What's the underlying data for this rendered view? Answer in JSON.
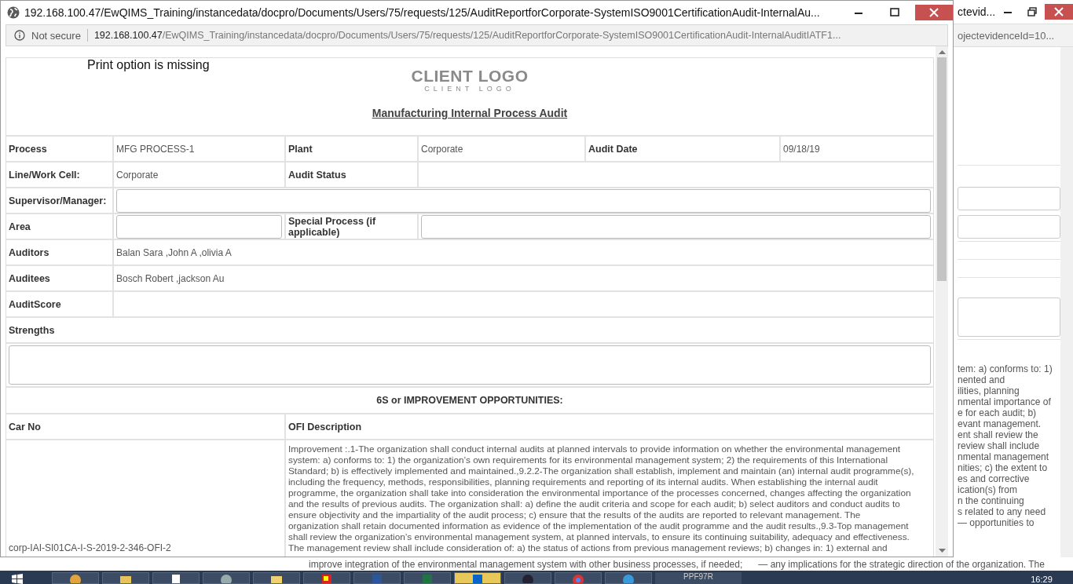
{
  "background_window": {
    "title": "ctevid...",
    "address": "ojectevidenceId=10...",
    "text_lines": [
      "tem: a) conforms to: 1)",
      "nented and",
      "ilities, planning",
      "nmental importance of",
      "e for each audit; b)",
      "evant management.",
      "ent shall review the",
      "review shall include",
      "nmental management",
      "nities; c) the extent to",
      "es and corrective",
      "ication(s) from",
      "n the continuing",
      "s related to any need",
      "— opportunities to"
    ],
    "bottom_texts": [
      "improve integration of the environmental management system with other business processes, if needed;",
      "— any implications for the strategic direction of the organization. The"
    ]
  },
  "popup": {
    "title": "192.168.100.47/EwQIMS_Training/instancedata/docpro/Documents/Users/75/requests/125/AuditReportforCorporate-SystemISO9001CertificationAudit-InternalAu...",
    "security": "Not secure",
    "url_host": "192.168.100.47",
    "url_path": "/EwQIMS_Training/instancedata/docpro/Documents/Users/75/requests/125/AuditReportforCorporate-SystemISO9001CertificationAudit-InternalAuditIATF1..."
  },
  "document": {
    "note": "Print option is missing",
    "logo": "CLIENT LOGO",
    "logo_sub": "CLIENT LOGO",
    "title": "Manufacturing Internal Process Audit",
    "rows": [
      {
        "kind": "six",
        "cells": [
          {
            "kind": "label",
            "text": "Process"
          },
          {
            "kind": "value",
            "text": "MFG PROCESS-1"
          },
          {
            "kind": "label",
            "text": "Plant"
          },
          {
            "kind": "value",
            "text": "Corporate"
          },
          {
            "kind": "label",
            "text": "Audit Date"
          },
          {
            "kind": "value",
            "text": "09/18/19"
          }
        ]
      },
      {
        "kind": "four",
        "cells": [
          {
            "kind": "label",
            "text": "Line/Work Cell:"
          },
          {
            "kind": "value",
            "text": "Corporate"
          },
          {
            "kind": "label",
            "text": "Audit Status"
          },
          {
            "kind": "empty"
          }
        ]
      },
      {
        "kind": "two",
        "cells": [
          {
            "kind": "label",
            "text": "Supervisor/Manager:"
          },
          {
            "kind": "input"
          }
        ]
      },
      {
        "kind": "four",
        "cells": [
          {
            "kind": "label",
            "text": "Area"
          },
          {
            "kind": "input"
          },
          {
            "kind": "label",
            "text": "Special Process (if applicable)"
          },
          {
            "kind": "input"
          }
        ]
      },
      {
        "kind": "two",
        "cells": [
          {
            "kind": "label",
            "text": "Auditors"
          },
          {
            "kind": "value",
            "text": "Balan Sara ,John A ,olivia A"
          }
        ]
      },
      {
        "kind": "two",
        "cells": [
          {
            "kind": "label",
            "text": "Auditees"
          },
          {
            "kind": "value",
            "text": "Bosch Robert ,jackson Au"
          }
        ]
      },
      {
        "kind": "two",
        "cells": [
          {
            "kind": "label",
            "text": "AuditScore"
          },
          {
            "kind": "empty"
          }
        ]
      }
    ],
    "strengths_label": "Strengths",
    "section_heading": "6S or IMPROVEMENT OPPORTUNITIES:",
    "ofi_table": {
      "columns": [
        "Car No",
        "OFI Description"
      ],
      "rows": [
        {
          "car_no": "corp-IAI-SI01CA-I-S-2019-2-346-OFI-2",
          "description": "Improvement :.1-The organization shall conduct internal audits at planned intervals to provide information on whether the environmental management\nsystem: a) conforms to: 1) the organization’s own requirements for its environmental management system; 2) the requirements of this International\nStandard; b) is effectively implemented and maintained.,9.2.2-The organization shall establish, implement and maintain (an) internal audit programme(s),\nincluding the frequency, methods, responsibilities, planning requirements and reporting of its internal audits. When establishing the internal audit\nprogramme, the organization shall take into consideration the environmental importance of the processes concerned, changes affecting the organization\nand the results of previous audits. The organization shall: a) define the audit criteria and scope for each audit; b) select auditors and conduct audits to\nensure objectivity and the impartiality of the audit process; c) ensure that the results of the audits are reported to relevant management. The\norganization shall retain documented information as evidence of the implementation of the audit programme and the audit results.,9.3-Top management\nshall review the organization’s environmental management system, at planned intervals, to ensure its continuing suitability, adequacy and effectiveness.\nThe management review shall include consideration of: a) the status of actions from previous management reviews; b) changes in: 1) external and"
        }
      ]
    }
  },
  "taskbar": {
    "button_label": "PPF97R",
    "clock": "16:29"
  }
}
